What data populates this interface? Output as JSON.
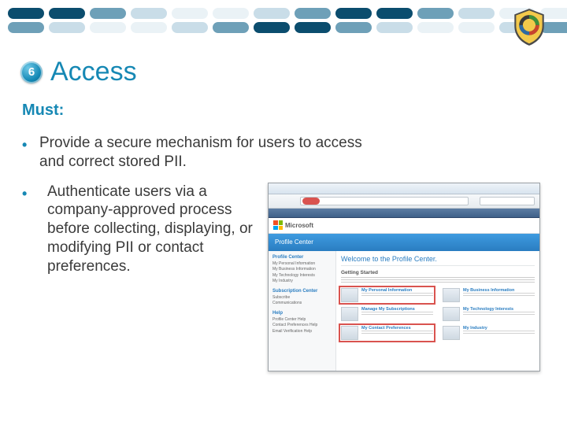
{
  "header": {
    "step_number": "6",
    "title": "Access"
  },
  "subhead": "Must:",
  "bullets": [
    "Provide a secure mechanism for users to access and correct stored PII.",
    "Authenticate users via a company-approved process before collecting, displaying, or modifying PII or contact preferences."
  ],
  "screenshot": {
    "brand": "Microsoft",
    "page_title": "Profile Center",
    "welcome": "Welcome to the Profile Center.",
    "getting_started": "Getting Started",
    "sidebar": {
      "group1": "Profile Center",
      "items1": [
        "My Personal Information",
        "My Business Information",
        "My Technology Interests",
        "My Industry"
      ],
      "group2": "Subscription Center",
      "items2": [
        "Subscribe",
        "Communications"
      ],
      "group3": "Help",
      "items3": [
        "Profile Center Help",
        "Contact Preferences Help",
        "Email Verification Help"
      ]
    },
    "tiles": [
      "My Personal Information",
      "My Business Information",
      "Manage My Subscriptions",
      "My Technology Interests",
      "My Contact Preferences",
      "My Industry"
    ]
  }
}
